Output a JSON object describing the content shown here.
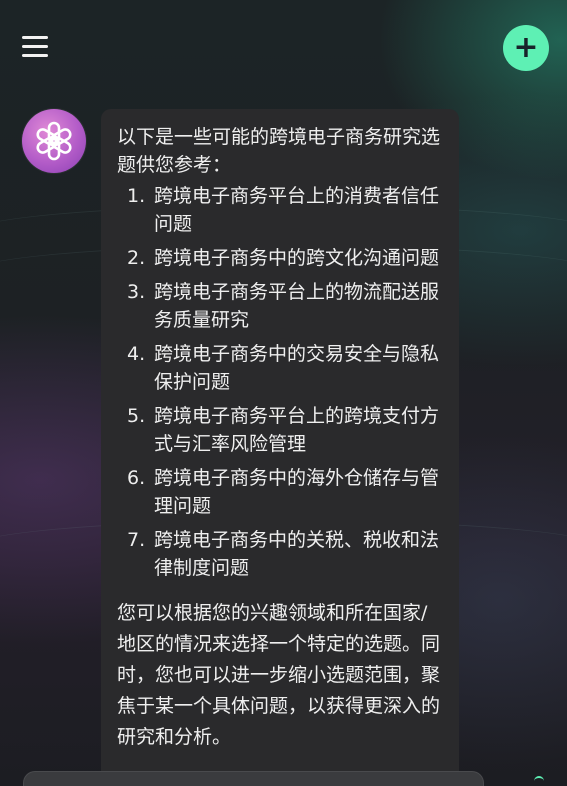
{
  "header": {
    "menu_icon": "hamburger-menu-icon",
    "new_chat_icon": "plus-icon",
    "new_chat_glyph": "+",
    "accent_color": "#5ef0b4"
  },
  "assistant": {
    "avatar_icon": "openai-logo-icon",
    "avatar_color": "#c06ad0"
  },
  "message": {
    "intro": "以下是一些可能的跨境电子商务研究选题供您参考：",
    "items": [
      {
        "num": "1.",
        "text": "跨境电子商务平台上的消费者信任问题"
      },
      {
        "num": "2.",
        "text": "跨境电子商务中的跨文化沟通问题"
      },
      {
        "num": "3.",
        "text": "跨境电子商务平台上的物流配送服务质量研究"
      },
      {
        "num": "4.",
        "text": "跨境电子商务中的交易安全与隐私保护问题"
      },
      {
        "num": "5.",
        "text": "跨境电子商务平台上的跨境支付方式与汇率风险管理"
      },
      {
        "num": "6.",
        "text": "跨境电子商务中的海外仓储存与管理问题"
      },
      {
        "num": "7.",
        "text": "跨境电子商务中的关税、税收和法律制度问题"
      }
    ],
    "outro": "您可以根据您的兴趣领域和所在国家/地区的情况来选择一个特定的选题。同时，您也可以进一步缩小选题范围，聚焦于某一个具体问题，以获得更深入的研究和分析。"
  },
  "composer": {
    "placeholder": ""
  }
}
